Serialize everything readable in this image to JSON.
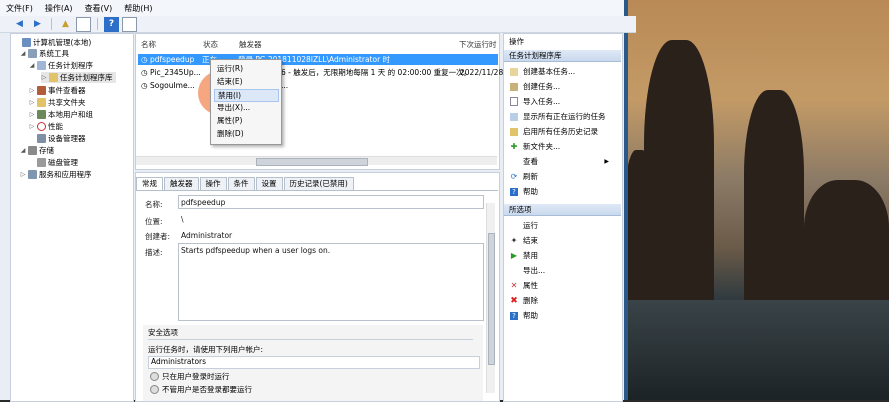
{
  "menubar": {
    "items": [
      "文件(F)",
      "操作(A)",
      "查看(V)",
      "帮助(H)"
    ]
  },
  "tree": {
    "items": [
      {
        "label": "计算机管理(本地)",
        "level": 0,
        "expander": ""
      },
      {
        "label": "系统工具",
        "level": 1,
        "expander": "◢"
      },
      {
        "label": "任务计划程序",
        "level": 2,
        "expander": "◢"
      },
      {
        "label": "任务计划程序库",
        "level": 3,
        "expander": "▷"
      },
      {
        "label": "事件查看器",
        "level": 2,
        "expander": "▷"
      },
      {
        "label": "共享文件夹",
        "level": 2,
        "expander": "▷"
      },
      {
        "label": "本地用户和组",
        "level": 2,
        "expander": "▷"
      },
      {
        "label": "性能",
        "level": 2,
        "expander": "▷"
      },
      {
        "label": "设备管理器",
        "level": 2,
        "expander": ""
      },
      {
        "label": "存储",
        "level": 1,
        "expander": "◢"
      },
      {
        "label": "磁盘管理",
        "level": 2,
        "expander": ""
      },
      {
        "label": "服务和应用程序",
        "level": 1,
        "expander": "▷"
      }
    ]
  },
  "task_list": {
    "columns": [
      "名称",
      "状态",
      "触发器",
      "下次运行时"
    ],
    "rows": [
      {
        "name": "pdfspeedup",
        "status": "正在...",
        "trigger": "登录 PC-201811028IZLL\\Administrator 时",
        "next": ""
      },
      {
        "name": "Pic_2345Up...",
        "status": "",
        "trigger": "6 - 触发后，无限期地每隔 1 天 的 02:00:00 重复一次。",
        "next": "2022/11/28"
      },
      {
        "name": "SogouIme...",
        "status": "",
        "trigger": "...",
        "next": ""
      }
    ]
  },
  "context_menu": {
    "items": [
      "运行(R)",
      "结束(E)",
      "禁用(I)",
      "导出(X)...",
      "属性(P)",
      "删除(D)"
    ],
    "highlighted": 2
  },
  "detail": {
    "tabs": [
      "常规",
      "触发器",
      "操作",
      "条件",
      "设置",
      "历史记录(已禁用)"
    ],
    "name_label": "名称:",
    "name_value": "pdfspeedup",
    "location_label": "位置:",
    "location_value": "\\",
    "author_label": "创建者:",
    "author_value": "Administrator",
    "desc_label": "描述:",
    "desc_value": "Starts pdfspeedup when a user logs on.",
    "security_title": "安全选项",
    "run_as_label": "运行任务时，请使用下列用户帐户:",
    "run_as_value": "Administrators",
    "radio1": "只在用户登录时运行",
    "radio2": "不管用户是否登录都要运行"
  },
  "actions": {
    "header1": "操作",
    "section1": "任务计划程序库",
    "items1": [
      {
        "label": "创建基本任务...",
        "icon": "create-basic-task-icon"
      },
      {
        "label": "创建任务...",
        "icon": "create-task-icon"
      },
      {
        "label": "导入任务...",
        "icon": "import-icon"
      },
      {
        "label": "显示所有正在运行的任务",
        "icon": "running-tasks-icon"
      },
      {
        "label": "启用所有任务历史记录",
        "icon": "history-icon"
      },
      {
        "label": "新文件夹...",
        "icon": "new-folder-icon"
      },
      {
        "label": "查看",
        "icon": "view-icon"
      },
      {
        "label": "刷新",
        "icon": "refresh-icon"
      },
      {
        "label": "帮助",
        "icon": "help-icon"
      }
    ],
    "section2": "所选项",
    "items2": [
      {
        "label": "运行",
        "icon": "run-icon"
      },
      {
        "label": "结束",
        "icon": "end-icon"
      },
      {
        "label": "禁用",
        "icon": "disable-icon"
      },
      {
        "label": "导出...",
        "icon": "export-icon"
      },
      {
        "label": "属性",
        "icon": "properties-icon"
      },
      {
        "label": "删除",
        "icon": "delete-icon"
      },
      {
        "label": "帮助",
        "icon": "help-icon"
      }
    ]
  },
  "colors": {
    "selection": "#3399ff",
    "accent": "#2b5a8a",
    "highlight_circle": "#f07a3c"
  }
}
